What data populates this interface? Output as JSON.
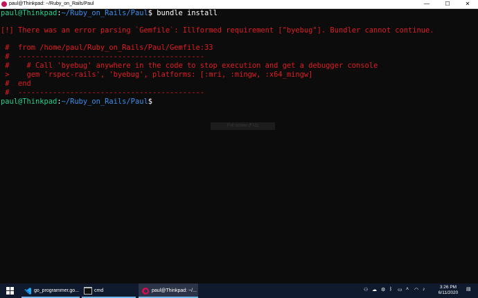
{
  "window": {
    "title": "paul@Thinkpad: ~/Ruby_on_Rails/Paul",
    "minimize": "—",
    "maximize": "☐",
    "close": "✕"
  },
  "terminal": {
    "prompt_user": "paul@Thinkpad",
    "prompt_sep": ":",
    "prompt_path": "~/Ruby_on_Rails/Paul",
    "prompt_dollar": "$",
    "command": " bundle install",
    "lines": [
      "[!] There was an error parsing `Gemfile`: Illformed requirement [\"byebug\"]. Bundler cannot continue.",
      " #  from /home/paul/Ruby_on_Rails/Paul/Gemfile:33",
      " #  -------------------------------------------",
      " #    # Call 'byebug' anywhere in the code to stop execution and get a debugger console",
      " >    gem 'rspec-rails', 'byebug', platforms: [:mri, :mingw, :x64_mingw]",
      " #  end",
      " #  -------------------------------------------"
    ]
  },
  "tooltip": "Full screen (F11)",
  "taskbar": {
    "start_icon": "windows-logo-icon",
    "items": [
      {
        "label": "go_programmer.go...",
        "icon": "vscode-icon"
      },
      {
        "label": "cmd",
        "icon": "cmd-icon"
      },
      {
        "label": "paul@Thinkpad: ~/...",
        "icon": "debian-icon"
      }
    ],
    "clock_time": "3:26 PM",
    "clock_date": "6/11/2020"
  },
  "colors": {
    "background": "#0c0c0c",
    "prompt_green": "#23d18b",
    "path_blue": "#3b8eea",
    "error_red": "#e11d21",
    "taskbar": "#0f1a2e"
  }
}
